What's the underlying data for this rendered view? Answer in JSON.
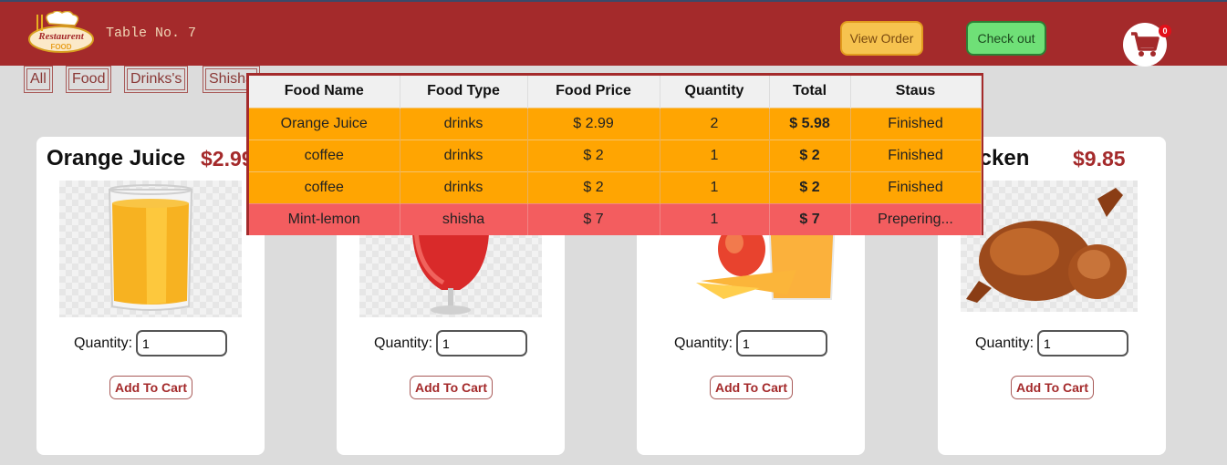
{
  "header": {
    "logo_text_top": "Restaurent",
    "logo_text_bottom": "FOOD",
    "table_label": "Table No. 7",
    "view_order_label": "View Order",
    "checkout_label": "Check out",
    "cart_count": "0"
  },
  "filters": [
    "All",
    "Food",
    "Drinks's",
    "Shisha"
  ],
  "products": [
    {
      "name": "Orange Juice",
      "price": "$2.99",
      "quantity_label": "Quantity:",
      "quantity_value": "1",
      "add_label": "Add To Cart"
    },
    {
      "name": "",
      "price": "",
      "quantity_label": "Quantity:",
      "quantity_value": "1",
      "add_label": "Add To Cart"
    },
    {
      "name": "",
      "price": "",
      "quantity_label": "Quantity:",
      "quantity_value": "1",
      "add_label": "Add To Cart"
    },
    {
      "name": "chicken",
      "price": "$9.85",
      "quantity_label": "Quantity:",
      "quantity_value": "1",
      "add_label": "Add To Cart"
    }
  ],
  "order": {
    "columns": [
      "Food Name",
      "Food Type",
      "Food Price",
      "Quantity",
      "Total",
      "Staus"
    ],
    "rows": [
      {
        "name": "Orange Juice",
        "type": "drinks",
        "price": "$ 2.99",
        "quantity": "2",
        "total": "$ 5.98",
        "status": "Finished"
      },
      {
        "name": "coffee",
        "type": "drinks",
        "price": "$ 2",
        "quantity": "1",
        "total": "$ 2",
        "status": "Finished"
      },
      {
        "name": "coffee",
        "type": "drinks",
        "price": "$ 2",
        "quantity": "1",
        "total": "$ 2",
        "status": "Finished"
      },
      {
        "name": "Mint-lemon",
        "type": "shisha",
        "price": "$ 7",
        "quantity": "1",
        "total": "$ 7",
        "status": "Prepering..."
      }
    ]
  },
  "colors": {
    "header": "#a42a2b",
    "finished_row": "#ffa502",
    "preparing_row": "#f35d5f",
    "view_order": "#f6c34f",
    "checkout": "#6fe077"
  }
}
